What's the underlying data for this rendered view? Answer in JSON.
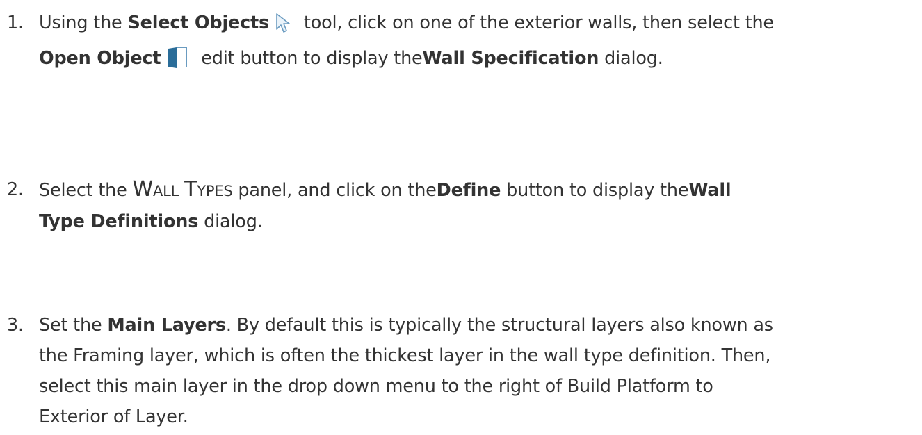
{
  "steps": [
    {
      "number": "1.",
      "t1": "Using the ",
      "b1": "Select Objects",
      "icon1": "select-objects-arrow-icon",
      "t2": " tool, click on one of the exterior walls, then select the",
      "b2": "Open Object",
      "icon2": "open-object-door-icon",
      "t3": " edit button to display the",
      "b3": "Wall Specification",
      "t4": " dialog."
    },
    {
      "number": "2.",
      "t1": "Select the ",
      "sc1_big": "W",
      "sc1_small": "ALL",
      "sc2_big": "T",
      "sc2_small": "YPES",
      "t2": " panel, and click on the",
      "b1": "Define",
      "t3": " button to display the",
      "b2": "Wall",
      "b3": "Type Definitions",
      "t4": " dialog."
    },
    {
      "number": "3.",
      "t1": "Set the",
      "b1": "Main Layers",
      "t2": ". By default this is typically the structural layers also known as",
      "t3": "the Framing layer, which is often the thickest layer in the wall type definition. Then,",
      "t4": "select this main layer in the drop down menu to the right of Build Platform to",
      "t5": "Exterior of Layer."
    }
  ],
  "colors": {
    "text": "#333333",
    "icon_blue": "#2a6d99",
    "icon_outline": "#6a9bc0"
  }
}
